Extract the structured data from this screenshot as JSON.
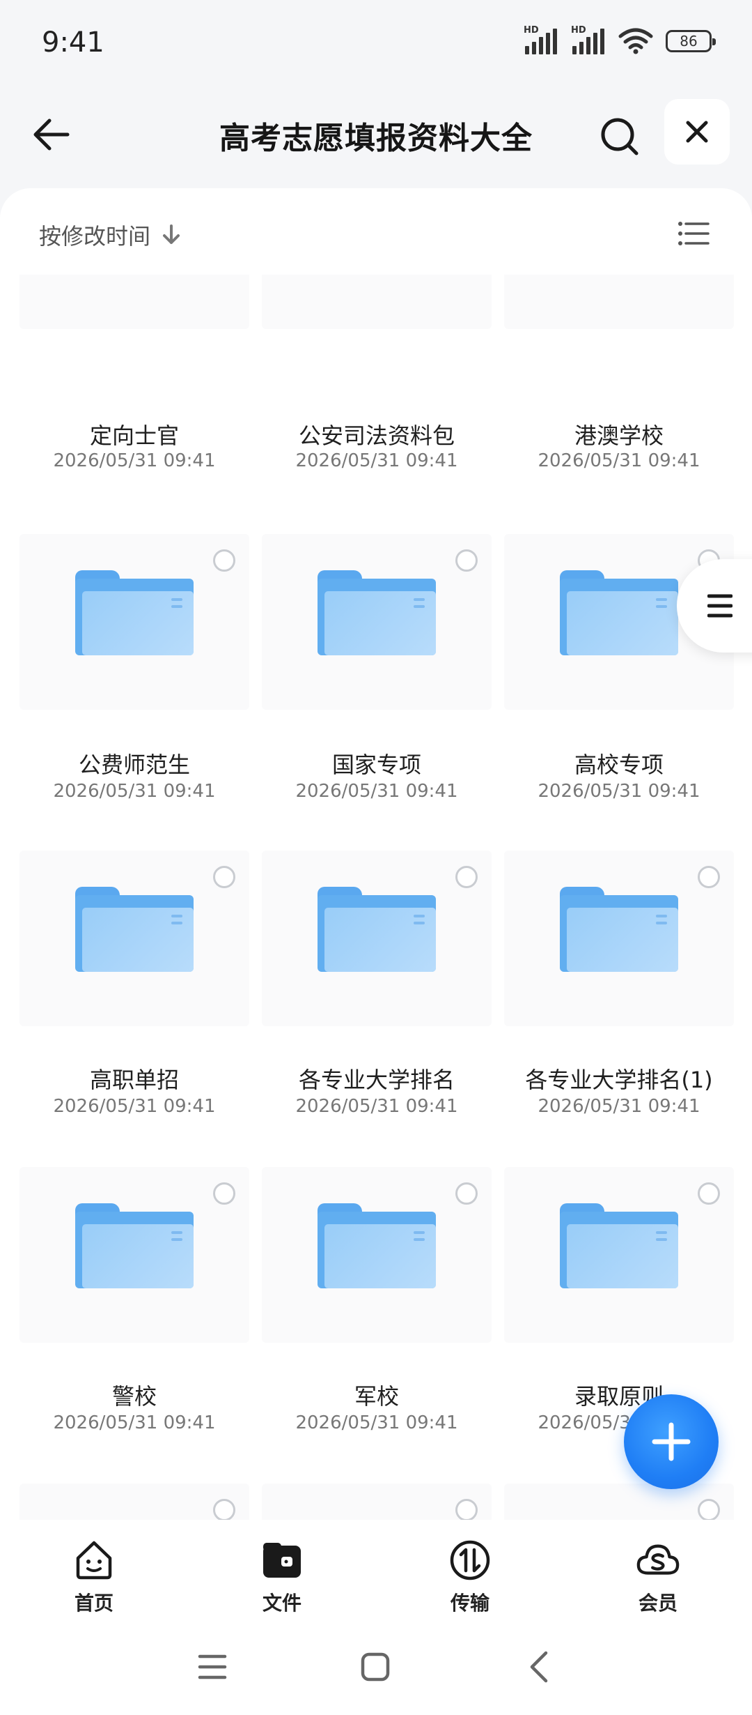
{
  "status": {
    "time": "9:41",
    "sig1_label": "HD",
    "sig2_label": "HD",
    "battery": "86"
  },
  "header": {
    "title": "高考志愿填报资料大全"
  },
  "toolbar": {
    "sort_label": "按修改时间"
  },
  "folders": [
    {
      "name": "定向士官",
      "date": "2026/05/31 09:41"
    },
    {
      "name": "公安司法资料包",
      "date": "2026/05/31 09:41"
    },
    {
      "name": "港澳学校",
      "date": "2026/05/31 09:41"
    },
    {
      "name": "公费师范生",
      "date": "2026/05/31 09:41"
    },
    {
      "name": "国家专项",
      "date": "2026/05/31 09:41"
    },
    {
      "name": "高校专项",
      "date": "2026/05/31 09:41"
    },
    {
      "name": "高职单招",
      "date": "2026/05/31 09:41"
    },
    {
      "name": "各专业大学排名",
      "date": "2026/05/31 09:41"
    },
    {
      "name": "各专业大学排名(1)",
      "date": "2026/05/31 09:41"
    },
    {
      "name": "警校",
      "date": "2026/05/31 09:41"
    },
    {
      "name": "军校",
      "date": "2026/05/31 09:41"
    },
    {
      "name": "录取原则",
      "date": "2026/05/31 09:41"
    },
    {
      "name": "",
      "date": ""
    },
    {
      "name": "",
      "date": ""
    },
    {
      "name": "",
      "date": ""
    }
  ],
  "nav": [
    {
      "label": "首页",
      "icon": "home-face-icon"
    },
    {
      "label": "文件",
      "icon": "wallet-folder-icon"
    },
    {
      "label": "传输",
      "icon": "transfer-icon"
    },
    {
      "label": "会员",
      "icon": "cloud-s-icon"
    }
  ],
  "colors": {
    "accent": "#1f7ef5",
    "folder": "#61aef0"
  }
}
